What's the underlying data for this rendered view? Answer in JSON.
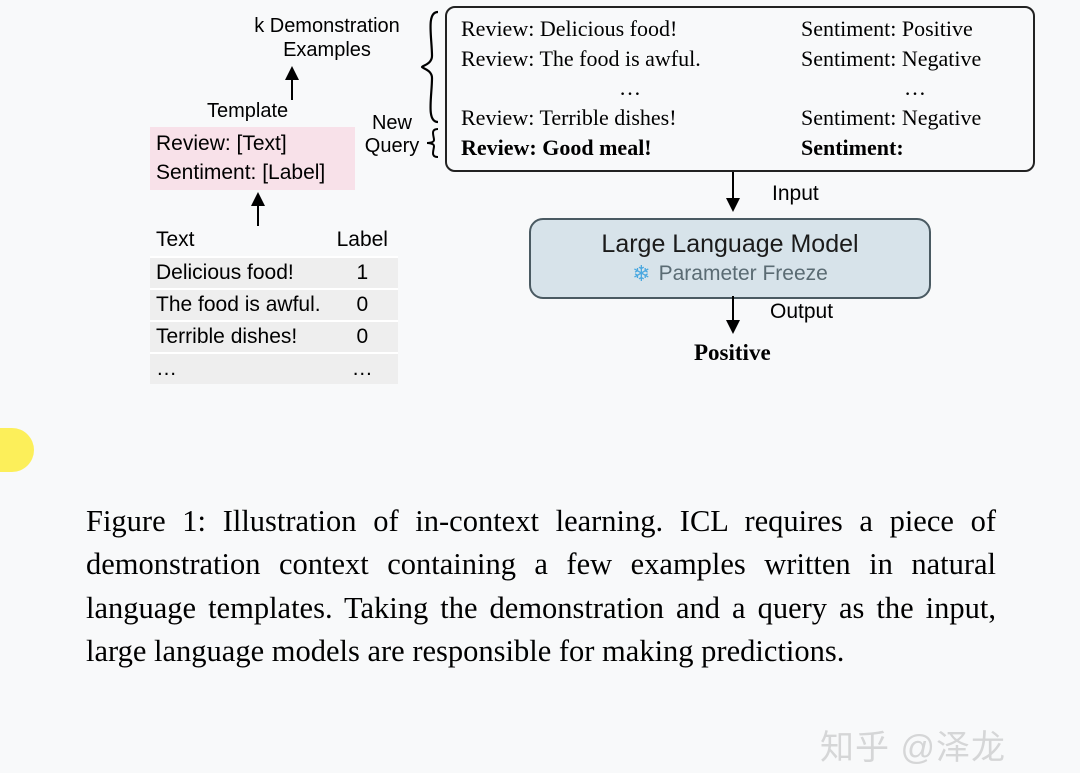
{
  "labels": {
    "k_demo": "k Demonstration\nExamples",
    "template": "Template",
    "new_query": "New\nQuery",
    "input": "Input",
    "output": "Output"
  },
  "template_box": {
    "line1": "Review: [Text]",
    "line2": "Sentiment: [Label]"
  },
  "table": {
    "headers": {
      "text": "Text",
      "label": "Label"
    },
    "rows": [
      {
        "text": "Delicious food!",
        "label": "1"
      },
      {
        "text": "The food is awful.",
        "label": "0"
      },
      {
        "text": "Terrible dishes!",
        "label": "0"
      }
    ],
    "ellipsis": "…"
  },
  "prompt": {
    "review_prefix": "Review:",
    "sentiment_prefix": "Sentiment:",
    "demos": [
      {
        "review": "Delicious food!",
        "sentiment": "Positive"
      },
      {
        "review": "The food is awful.",
        "sentiment": "Negative"
      },
      {
        "review": "Terrible dishes!",
        "sentiment": "Negative"
      }
    ],
    "dots": "…",
    "query": {
      "review": "Good meal!",
      "sentiment": ""
    }
  },
  "llm": {
    "title": "Large Language Model",
    "subtitle": "Parameter Freeze",
    "snow_icon": "❄"
  },
  "output_value": "Positive",
  "caption": "Figure 1: Illustration of in-context learning. ICL requires a piece of demonstration context containing a few examples written in natural language templates. Taking the demonstration and a query as the input, large language models are responsible for making predictions.",
  "watermark": "知乎 @泽龙"
}
